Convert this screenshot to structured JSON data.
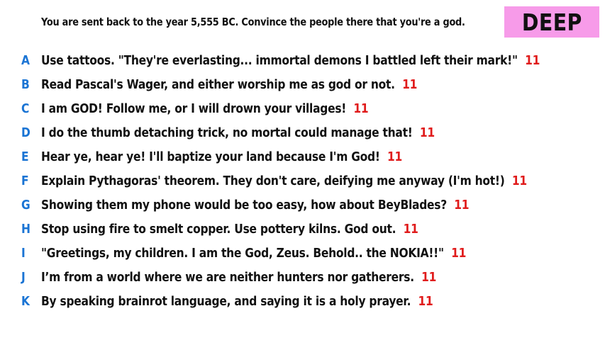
{
  "prompt": "You are sent back to the year 5,555 BC. Convince the people there that you're a god.",
  "badge": "DEEP",
  "colors": {
    "badge_bg": "#f79be9",
    "letter": "#1a74d4",
    "score": "#e01b1b"
  },
  "answers": [
    {
      "letter": "A",
      "text": "Use tattoos. \"They're everlasting... immortal demons I battled left their mark!\"",
      "score": "11"
    },
    {
      "letter": "B",
      "text": "Read Pascal's Wager, and either worship me as god or not.",
      "score": "11"
    },
    {
      "letter": "C",
      "text": "I am GOD! Follow me, or I will drown your villages!",
      "score": "11"
    },
    {
      "letter": "D",
      "text": "I do the thumb detaching trick, no mortal could manage that!",
      "score": "11"
    },
    {
      "letter": "E",
      "text": "Hear ye, hear ye! I'll baptize your land because I'm God!",
      "score": "11"
    },
    {
      "letter": "F",
      "text": "Explain Pythagoras' theorem. They don't care, deifying me anyway (I'm hot!)",
      "score": "11"
    },
    {
      "letter": "G",
      "text": "Showing them my phone would be too easy, how about BeyBlades?",
      "score": "11"
    },
    {
      "letter": "H",
      "text": "Stop using fire to smelt copper. Use pottery kilns. God out.",
      "score": "11"
    },
    {
      "letter": "I",
      "text": "\"Greetings, my children. I am the God, Zeus. Behold.. the NOKIA!!\"",
      "score": "11"
    },
    {
      "letter": "J",
      "text": "I’m from a world where we are neither hunters nor gatherers.",
      "score": "11"
    },
    {
      "letter": "K",
      "text": "By speaking brainrot language, and saying it is a holy prayer.",
      "score": "11"
    }
  ]
}
